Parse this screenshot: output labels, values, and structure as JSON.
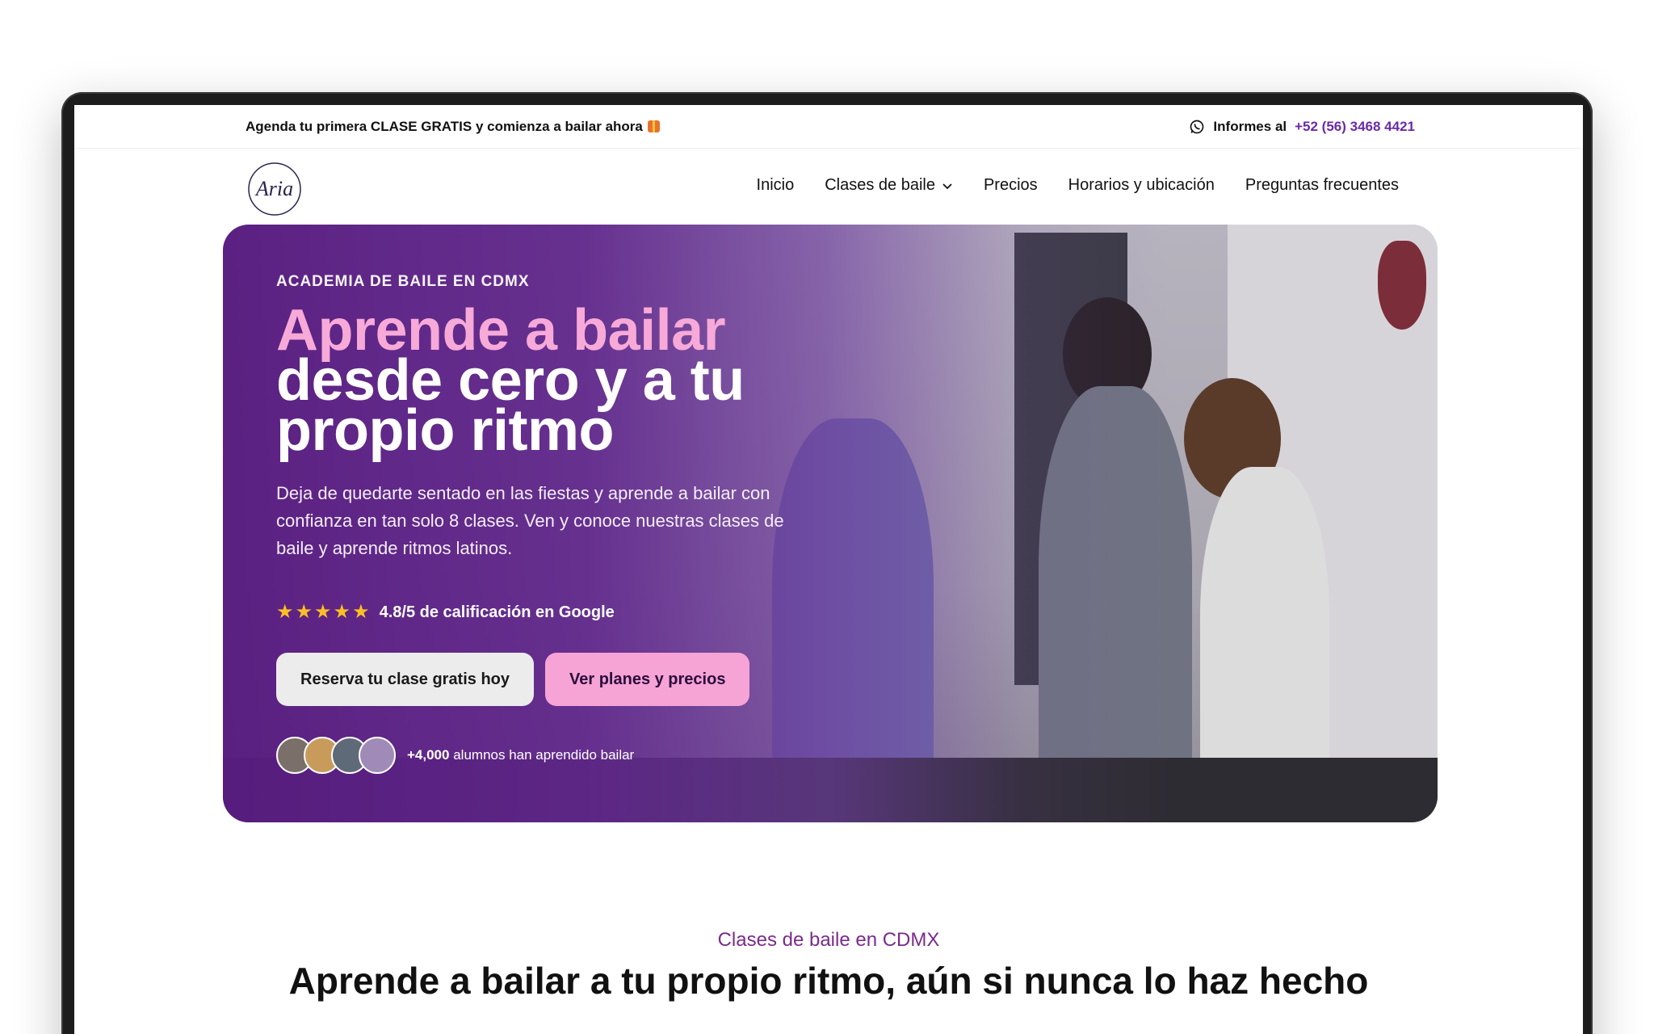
{
  "topbar": {
    "promo_text": "Agenda tu primera CLASE GRATIS y comienza a bailar ahora",
    "contact_label": "Informes al",
    "phone": "+52 (56) 3468 4421"
  },
  "nav": {
    "logo_text": "Aria",
    "items": [
      {
        "label": "Inicio"
      },
      {
        "label": "Clases de baile"
      },
      {
        "label": "Precios"
      },
      {
        "label": "Horarios y ubicación"
      },
      {
        "label": "Preguntas frecuentes"
      }
    ]
  },
  "hero": {
    "eyebrow": "ACADEMIA DE BAILE EN CDMX",
    "headline_pink": "Aprende a bailar",
    "headline_white_1": "desde cero y a tu",
    "headline_white_2": "propio ritmo",
    "lead": "Deja de quedarte sentado en las fiestas y aprende a bailar con confianza en tan solo 8 clases. Ven y conoce nuestras clases de baile y aprende ritmos latinos.",
    "rating_stars": 5,
    "rating_text": "4.8/5 de calificación en Google",
    "cta_primary": "Reserva tu clase gratis hoy",
    "cta_secondary": "Ver planes y precios",
    "students_count": "+4,000",
    "students_text": "alumnos han aprendido bailar"
  },
  "section": {
    "eyebrow": "Clases de baile en CDMX",
    "title": "Aprende a bailar a tu propio ritmo, aún si nunca lo haz hecho"
  },
  "colors": {
    "accent_purple": "#6a2aa8",
    "pink": "#f7a9d8",
    "button_pink": "#f6a3d6",
    "star": "#fbbf24"
  }
}
